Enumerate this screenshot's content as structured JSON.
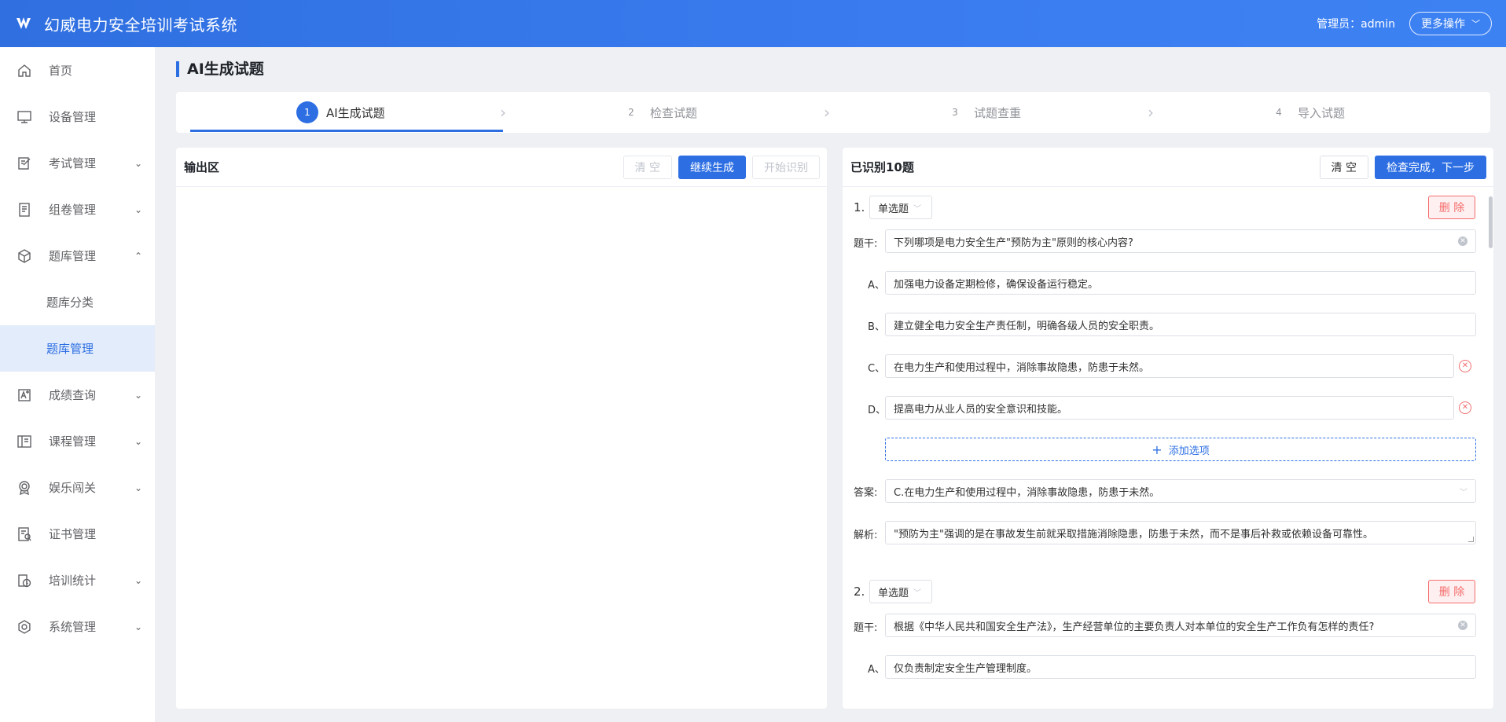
{
  "app": {
    "title": "幻威电力安全培训考试系统",
    "admin_label": "管理员：admin",
    "more_actions": "更多操作"
  },
  "sidebar": {
    "items": [
      {
        "label": "首页",
        "icon": "home-icon",
        "expandable": false
      },
      {
        "label": "设备管理",
        "icon": "monitor-icon",
        "expandable": false
      },
      {
        "label": "考试管理",
        "icon": "edit-icon",
        "expandable": true
      },
      {
        "label": "组卷管理",
        "icon": "document-icon",
        "expandable": true
      },
      {
        "label": "题库管理",
        "icon": "box-icon",
        "expandable": true,
        "expanded": true
      }
    ],
    "sub_items": [
      {
        "label": "题库分类",
        "active": false
      },
      {
        "label": "题库管理",
        "active": true
      }
    ],
    "items_after": [
      {
        "label": "成绩查询",
        "icon": "score-icon",
        "expandable": true
      },
      {
        "label": "课程管理",
        "icon": "book-icon",
        "expandable": true
      },
      {
        "label": "娱乐闯关",
        "icon": "medal-icon",
        "expandable": true
      },
      {
        "label": "证书管理",
        "icon": "certificate-icon",
        "expandable": false
      },
      {
        "label": "培训统计",
        "icon": "clock-icon",
        "expandable": true
      },
      {
        "label": "系统管理",
        "icon": "gear-icon",
        "expandable": true
      }
    ]
  },
  "page": {
    "title": "AI生成试题"
  },
  "steps": [
    {
      "num": "1",
      "label": "AI生成试题",
      "active": true
    },
    {
      "num": "2",
      "label": "检查试题",
      "active": false
    },
    {
      "num": "3",
      "label": "试题查重",
      "active": false
    },
    {
      "num": "4",
      "label": "导入试题",
      "active": false
    }
  ],
  "left_panel": {
    "title": "输出区",
    "clear": "清 空",
    "continue": "继续生成",
    "start_recognize": "开始识别"
  },
  "right_panel": {
    "title": "已识别10题",
    "clear": "清 空",
    "next": "检查完成，下一步",
    "labels": {
      "stem": "题干:",
      "answer": "答案:",
      "analysis": "解析:",
      "delete": "删 除",
      "add_option": "添加选项"
    },
    "questions": [
      {
        "num": "1.",
        "type": "单选题",
        "stem": "下列哪项是电力安全生产\"预防为主\"原则的核心内容?",
        "options": [
          {
            "key": "A、",
            "text": "加强电力设备定期检修，确保设备运行稳定。"
          },
          {
            "key": "B、",
            "text": "建立健全电力安全生产责任制，明确各级人员的安全职责。"
          },
          {
            "key": "C、",
            "text": "在电力生产和使用过程中，消除事故隐患，防患于未然。"
          },
          {
            "key": "D、",
            "text": "提高电力从业人员的安全意识和技能。"
          }
        ],
        "answer": "C.在电力生产和使用过程中，消除事故隐患，防患于未然。",
        "analysis": "\"预防为主\"强调的是在事故发生前就采取措施消除隐患，防患于未然，而不是事后补救或依赖设备可靠性。"
      },
      {
        "num": "2.",
        "type": "单选题",
        "stem": "根据《中华人民共和国安全生产法》，生产经营单位的主要负责人对本单位的安全生产工作负有怎样的责任?",
        "options": [
          {
            "key": "A、",
            "text": "仅负责制定安全生产管理制度。"
          }
        ]
      }
    ]
  },
  "colors": {
    "primary": "#2d6fe3",
    "danger": "#f56c6c",
    "header": "#3478ea"
  }
}
